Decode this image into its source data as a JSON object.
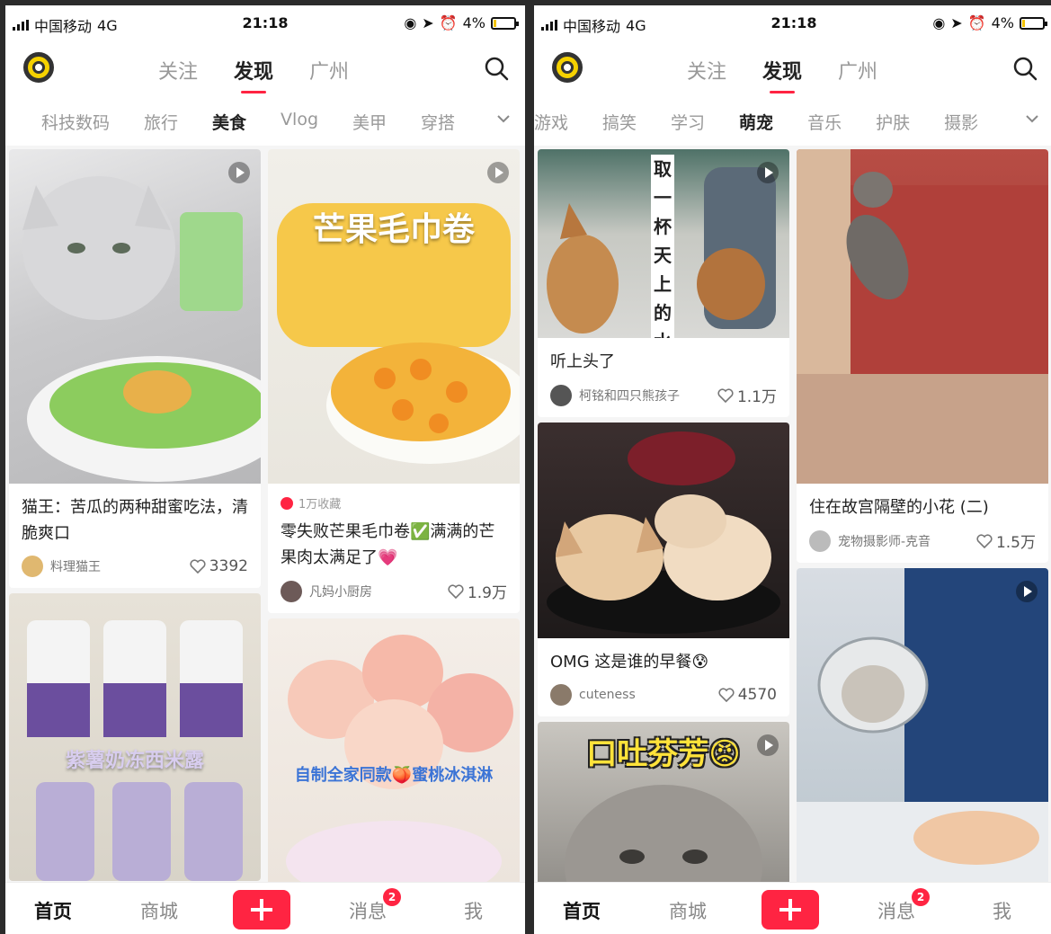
{
  "screens": [
    {
      "status": {
        "carrier": "中国移动",
        "network": "4G",
        "time": "21:18",
        "battery": "4%"
      },
      "tabs": [
        "关注",
        "发现",
        "广州"
      ],
      "active_tab": "发现",
      "categories": [
        "科技数码",
        "旅行",
        "美食",
        "Vlog",
        "美甲",
        "穿搭"
      ],
      "active_category": "美食",
      "cards": {
        "left": [
          {
            "title": "猫王：苦瓜的两种甜蜜吃法，清脆爽口",
            "author": "料理猫王",
            "likes": "3392",
            "has_video": true
          },
          {
            "image_text": "紫薯奶冻西米露",
            "has_video": false
          }
        ],
        "right": [
          {
            "image_text": "芒果毛巾卷",
            "collect": "1万收藏",
            "title": "零失败芒果毛巾卷✅满满的芒果肉太满足了💗",
            "author": "凡妈小厨房",
            "likes": "1.9万",
            "has_video": true
          },
          {
            "image_text": "自制全家同款🍑蜜桃冰淇淋",
            "has_video": false
          }
        ]
      },
      "bottom_nav": [
        "首页",
        "商城",
        "消息",
        "我"
      ],
      "message_badge": "2"
    },
    {
      "status": {
        "carrier": "中国移动",
        "network": "4G",
        "time": "21:18",
        "battery": "4%"
      },
      "tabs": [
        "关注",
        "发现",
        "广州"
      ],
      "active_tab": "发现",
      "categories": [
        "游戏",
        "搞笑",
        "学习",
        "萌宠",
        "音乐",
        "护肤",
        "摄影"
      ],
      "active_category": "萌宠",
      "cards": {
        "left": [
          {
            "image_text": "取一杯天上的水",
            "title": "听上头了",
            "author": "柯铭和四只熊孩子",
            "likes": "1.1万",
            "has_video": true
          },
          {
            "title": "OMG 这是谁的早餐😰",
            "author": "cuteness",
            "likes": "4570",
            "has_video": false
          },
          {
            "image_text": "口吐芬芳😡",
            "has_video": true
          }
        ],
        "right": [
          {
            "title": "住在故宫隔壁的小花 (二)",
            "author": "宠物摄影师-克音",
            "likes": "1.5万",
            "has_video": false
          },
          {
            "has_video": true
          }
        ]
      },
      "bottom_nav": [
        "首页",
        "商城",
        "消息",
        "我"
      ],
      "message_badge": "2"
    }
  ]
}
